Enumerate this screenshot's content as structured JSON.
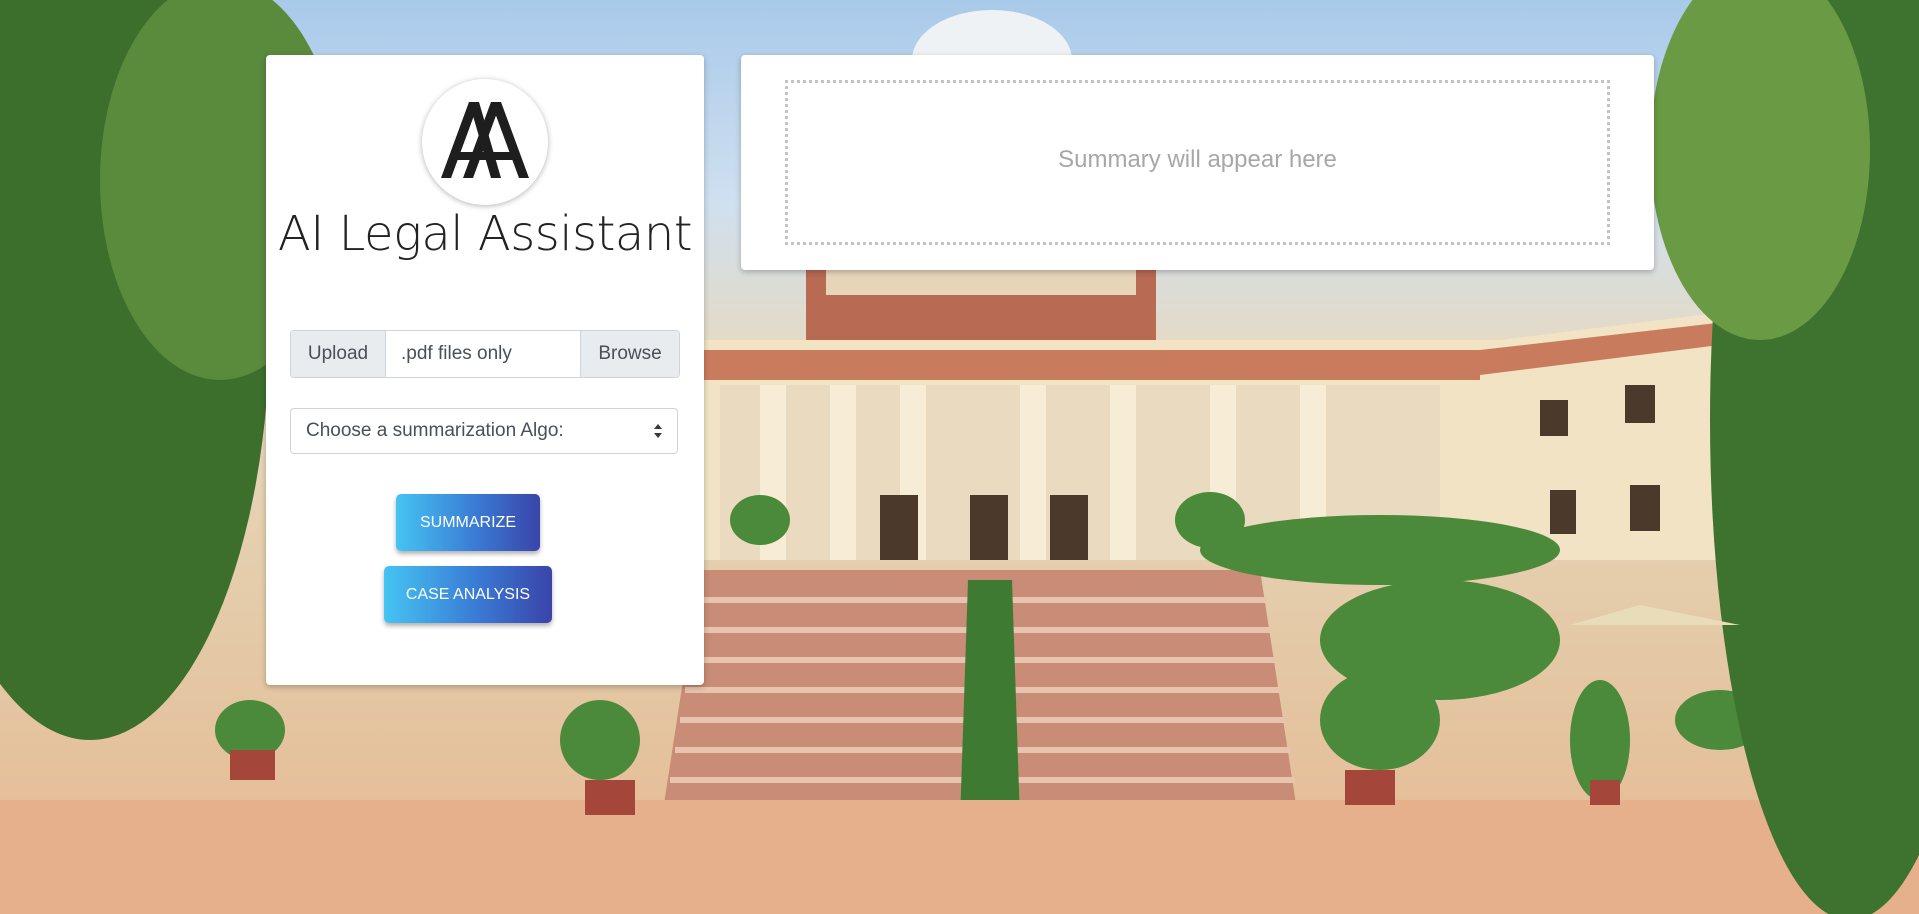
{
  "brand": {
    "title": "AI Legal Assistant",
    "logo_icon": "aa-monogram-icon"
  },
  "upload": {
    "label": "Upload",
    "placeholder": ".pdf files only",
    "browse_label": "Browse"
  },
  "algorithm_select": {
    "selected": "Choose a summarization Algo:",
    "icon": "select-arrows-icon"
  },
  "actions": {
    "summarize_label": "SUMMARIZE",
    "case_analysis_label": "CASE ANALYSIS"
  },
  "summary": {
    "placeholder": "Summary will appear here"
  },
  "colors": {
    "button_gradient_start": "#45c4f2",
    "button_gradient_end": "#3a44a9",
    "card_background": "#ffffff",
    "placeholder_text": "#a7a7a7"
  }
}
